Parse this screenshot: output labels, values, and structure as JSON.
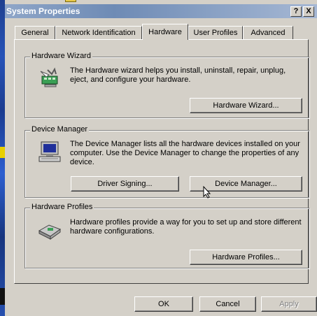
{
  "window": {
    "title": "System Properties",
    "help_label": "?",
    "close_label": "X"
  },
  "tabs": [
    {
      "label": "General",
      "active": false
    },
    {
      "label": "Network Identification",
      "active": false
    },
    {
      "label": "Hardware",
      "active": true
    },
    {
      "label": "User Profiles",
      "active": false
    },
    {
      "label": "Advanced",
      "active": false
    }
  ],
  "hardware_wizard": {
    "legend": "Hardware Wizard",
    "description": "The Hardware wizard helps you install, uninstall, repair, unplug, eject, and configure your hardware.",
    "button": "Hardware Wizard...",
    "icon": "hardware-wizard-icon"
  },
  "device_manager": {
    "legend": "Device Manager",
    "description": "The Device Manager lists all the hardware devices installed on your computer. Use the Device Manager to change the properties of any device.",
    "driver_signing_button": "Driver Signing...",
    "device_manager_button": "Device Manager...",
    "icon": "computer-icon"
  },
  "hardware_profiles": {
    "legend": "Hardware Profiles",
    "description": "Hardware profiles provide a way for you to set up and store different hardware configurations.",
    "button": "Hardware Profiles...",
    "icon": "hardware-profiles-icon"
  },
  "footer": {
    "ok": "OK",
    "cancel": "Cancel",
    "apply": "Apply"
  },
  "colors": {
    "title_gradient_start": "#8fa6c8",
    "face": "#d4d0c8",
    "disabled_text": "#808080"
  }
}
